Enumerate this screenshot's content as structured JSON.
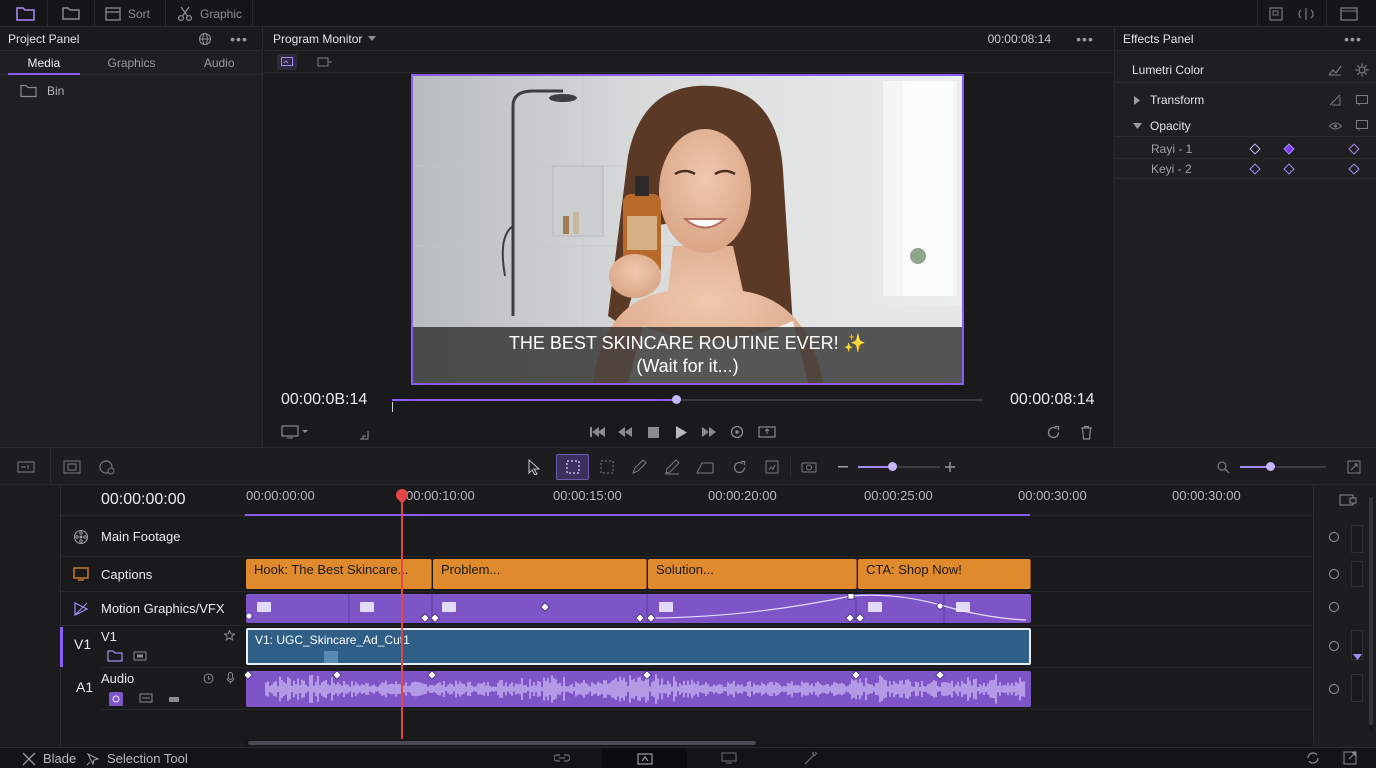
{
  "topbar": {
    "sort_label": "Sort",
    "graphic_label": "Graphic"
  },
  "project": {
    "title": "Project Panel",
    "tabs": [
      "Media",
      "Graphics",
      "Audio"
    ],
    "bin_label": "Bin"
  },
  "monitor": {
    "title": "Program Monitor",
    "timecode_top": "00:00:08:14",
    "caption_line1": "THE BEST SKINCARE ROUTINE EVER! ✨",
    "caption_line2": "(Wait for it...)",
    "timecode_left": "00:00:0B:14",
    "timecode_right": "00:00:08:14",
    "scrub_progress": 0.48
  },
  "effects": {
    "title": "Effects Panel",
    "lumetri": "Lumetri Color",
    "transform": "Transform",
    "opacity": "Opacity",
    "key1": "Rayi - 1",
    "key2": "Keyi - 2"
  },
  "timeline": {
    "current_time": "00:00:00:00",
    "ruler": [
      "00:00:00:00",
      "00:00:10:00",
      "00:00:15:00",
      "00:00:20:00",
      "00:00:25:00",
      "00:00:30:00",
      "00:00:30:00"
    ],
    "tracks": {
      "main": "Main Footage",
      "captions": "Captions",
      "motion": "Motion Graphics/VFX",
      "v1_id": "V1",
      "v1_name": "V1",
      "a1_id": "A1",
      "a1_name": "Audio"
    },
    "caption_clips": [
      "Hook: The Best Skincare...",
      "Problem...",
      "Solution...",
      "CTA: Shop Now!"
    ],
    "video_clip": "V1: UGC_Skincare_Ad_Cut1"
  },
  "status": {
    "blade": "Blade",
    "selection": "Selection Tool"
  },
  "colors": {
    "accent": "#8b5cf6",
    "caption": "#e08a2e",
    "video": "#2f5f86",
    "playhead": "#e04848"
  }
}
